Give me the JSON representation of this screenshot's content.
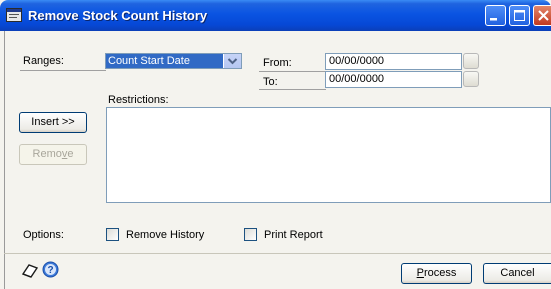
{
  "window": {
    "title": "Remove Stock Count History"
  },
  "ranges": {
    "label": "Ranges:",
    "selected": "Count Start Date"
  },
  "from": {
    "label": "From:",
    "value": "00/00/0000"
  },
  "to": {
    "label": "To:",
    "value": "00/00/0000"
  },
  "restrictions": {
    "label": "Restrictions:"
  },
  "buttons": {
    "insert": "Insert >>",
    "remove_pre": "Remo",
    "remove_u": "v",
    "remove_post": "e",
    "process_u": "P",
    "process_rest": "rocess",
    "cancel": "Cancel"
  },
  "options": {
    "label": "Options:",
    "remove_history": "Remove History",
    "print_report": "Print Report"
  },
  "colors": {
    "titlebar": "#0a54e2",
    "selection": "#316ac5"
  }
}
